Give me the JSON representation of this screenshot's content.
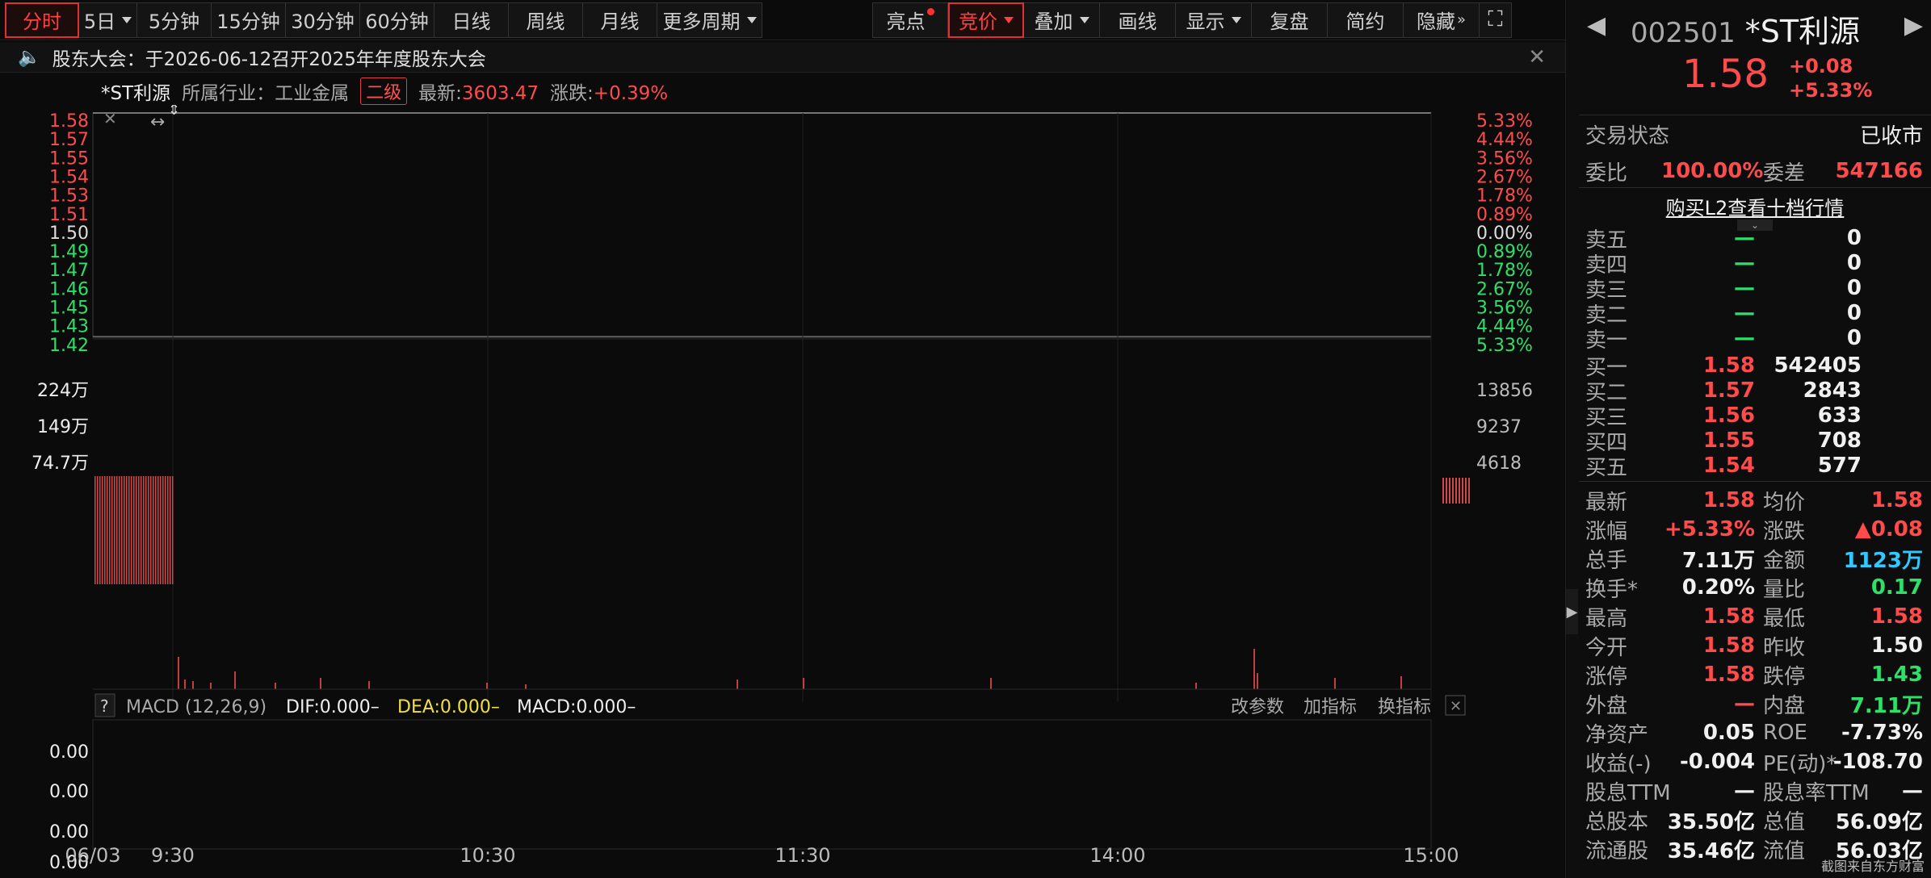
{
  "toolbar": {
    "tabs": [
      "分时",
      "5日",
      "5分钟",
      "15分钟",
      "30分钟",
      "60分钟",
      "日线",
      "周线",
      "月线",
      "更多周期"
    ],
    "tools": [
      "亮点",
      "竞价",
      "叠加",
      "画线",
      "显示",
      "复盘",
      "简约",
      "隐藏"
    ]
  },
  "notice": {
    "text": "股东大会：于2026-06-12召开2025年年度股东大会"
  },
  "info": {
    "name": "*ST利源",
    "industry_label": "所属行业：",
    "industry": "工业金属",
    "level": "二级",
    "latest_label": "最新:",
    "latest": "3603.47",
    "change_label": "涨跌:",
    "change": "+0.39%"
  },
  "price_axis": {
    "left": [
      "1.58",
      "1.57",
      "1.55",
      "1.54",
      "1.53",
      "1.51",
      "1.50",
      "1.49",
      "1.47",
      "1.46",
      "1.45",
      "1.43",
      "1.42"
    ],
    "right": [
      "5.33%",
      "4.44%",
      "3.56%",
      "2.67%",
      "1.78%",
      "0.89%",
      "0.00%",
      "0.89%",
      "1.78%",
      "2.67%",
      "3.56%",
      "4.44%",
      "5.33%"
    ]
  },
  "volume_axis": {
    "left": [
      "224万",
      "149万",
      "74.7万"
    ],
    "right": [
      "13856",
      "9237",
      "4618"
    ]
  },
  "macd": {
    "help": "?",
    "title": "MACD (12,26,9)",
    "dif": "DIF:0.000–",
    "dea": "DEA:0.000–",
    "macd": "MACD:0.000–",
    "links": [
      "改参数",
      "加指标",
      "换指标"
    ],
    "axis": [
      "0.00",
      "0.00",
      "0.00",
      "0.00"
    ]
  },
  "time_axis": [
    "06/03",
    "9:30",
    "10:30",
    "11:30",
    "14:00",
    "15:00"
  ],
  "quote": {
    "code": "002501",
    "name": "*ST利源",
    "price": "1.58",
    "change": "+0.08",
    "change_pct": "+5.33%"
  },
  "status": {
    "label": "交易状态",
    "value": "已收市"
  },
  "weibi": {
    "label1": "委比",
    "value1": "100.00%",
    "label2": "委差",
    "value2": "547166"
  },
  "l2_link": "购买L2查看十档行情",
  "sells": [
    {
      "label": "卖五",
      "price": "—",
      "vol": "0"
    },
    {
      "label": "卖四",
      "price": "—",
      "vol": "0"
    },
    {
      "label": "卖三",
      "price": "—",
      "vol": "0"
    },
    {
      "label": "卖二",
      "price": "—",
      "vol": "0"
    },
    {
      "label": "卖一",
      "price": "—",
      "vol": "0"
    }
  ],
  "buys": [
    {
      "label": "买一",
      "price": "1.58",
      "vol": "542405"
    },
    {
      "label": "买二",
      "price": "1.57",
      "vol": "2843"
    },
    {
      "label": "买三",
      "price": "1.56",
      "vol": "633"
    },
    {
      "label": "买四",
      "price": "1.55",
      "vol": "708"
    },
    {
      "label": "买五",
      "price": "1.54",
      "vol": "577"
    }
  ],
  "stats": [
    {
      "l1": "最新",
      "v1": "1.58",
      "c1": "red",
      "l2": "均价",
      "v2": "1.58",
      "c2": "red"
    },
    {
      "l1": "涨幅",
      "v1": "+5.33%",
      "c1": "red",
      "l2": "涨跌",
      "v2": "▲0.08",
      "c2": "red"
    },
    {
      "l1": "总手",
      "v1": "7.11万",
      "c1": "white",
      "l2": "金额",
      "v2": "1123万",
      "c2": "cyan"
    },
    {
      "l1": "换手*",
      "v1": "0.20%",
      "c1": "white",
      "l2": "量比",
      "v2": "0.17",
      "c2": "green"
    },
    {
      "l1": "最高",
      "v1": "1.58",
      "c1": "red",
      "l2": "最低",
      "v2": "1.58",
      "c2": "red"
    },
    {
      "l1": "今开",
      "v1": "1.58",
      "c1": "red",
      "l2": "昨收",
      "v2": "1.50",
      "c2": "white"
    },
    {
      "l1": "涨停",
      "v1": "1.58",
      "c1": "red",
      "l2": "跌停",
      "v2": "1.43",
      "c2": "green"
    },
    {
      "l1": "外盘",
      "v1": "—",
      "c1": "red",
      "l2": "内盘",
      "v2": "7.11万",
      "c2": "green"
    },
    {
      "l1": "净资产",
      "v1": "0.05",
      "c1": "white",
      "l2": "ROE",
      "v2": "-7.73%",
      "c2": "white"
    },
    {
      "l1": "收益(-)",
      "v1": "-0.004",
      "c1": "white",
      "l2": "PE(动)*",
      "v2": "-108.70",
      "c2": "white"
    },
    {
      "l1": "股息TTM",
      "v1": "—",
      "c1": "white",
      "l2": "股息率TTM",
      "v2": "—",
      "c2": "white"
    },
    {
      "l1": "总股本",
      "v1": "35.50亿",
      "c1": "white",
      "l2": "总值",
      "v2": "56.09亿",
      "c2": "white"
    },
    {
      "l1": "流通股",
      "v1": "35.46亿",
      "c1": "white",
      "l2": "流值",
      "v2": "56.03亿",
      "c2": "white"
    }
  ],
  "watermark": "截图来自东方财富",
  "colors": {
    "up": "#ff4b4b",
    "down": "#2ee06a",
    "accent": "#e03030"
  }
}
